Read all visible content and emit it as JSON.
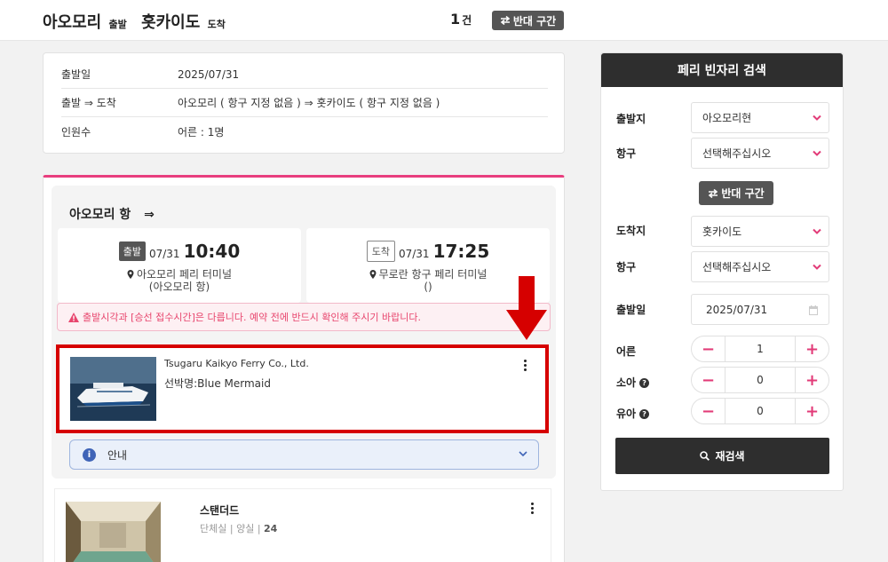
{
  "header": {
    "origin": "아오모리",
    "origin_suffix": "출발",
    "destination": "홋카이도",
    "destination_suffix": "도착",
    "count": "1",
    "count_unit": "건",
    "reverse_label": "반대 구간"
  },
  "summary": {
    "rows": [
      {
        "label": "출발일",
        "value": "2025/07/31"
      },
      {
        "label": "출발 ⇒ 도착",
        "value": "아오모리 ( 항구 지정 없음 ) ⇒ 홋카이도 ( 항구 지정 없음 )"
      },
      {
        "label": "인원수",
        "value": "어른 : 1명"
      }
    ]
  },
  "result": {
    "port_title": "아오모리 항",
    "port_arrow": "⇒",
    "departure": {
      "badge": "출발",
      "date": "07/31",
      "time": "10:40",
      "terminal": "아오모리 페리 터미널",
      "terminal_sub": "(아오모리 항)"
    },
    "arrival": {
      "badge": "도착",
      "date": "07/31",
      "time": "17:25",
      "terminal": "무로란 항구 페리 터미널",
      "terminal_sub": "()"
    },
    "warning": "출발시각과 [승선 접수시간]은 다릅니다. 예약 전에 반드시 확인해 주시기 바랍니다.",
    "ship": {
      "company": "Tsugaru Kaikyo Ferry Co., Ltd.",
      "name": "선박명:Blue Mermaid"
    },
    "info_label": "안내",
    "room": {
      "title": "스탠더드",
      "meta_1": "단체실",
      "meta_2": "양실",
      "meta_3": "24"
    }
  },
  "search": {
    "title": "페리 빈자리 검색",
    "departure_label": "출발지",
    "departure_value": "아오모리현",
    "dep_port_label": "항구",
    "dep_port_value": "선택해주십시오",
    "reverse_label": "반대 구간",
    "arrival_label": "도착지",
    "arrival_value": "홋카이도",
    "arr_port_label": "항구",
    "arr_port_value": "선택해주십시오",
    "date_label": "출발일",
    "date_value": "2025/07/31",
    "adult_label": "어른",
    "adult_value": "1",
    "child_label": "소아",
    "child_value": "0",
    "infant_label": "유아",
    "infant_value": "0",
    "minus": "−",
    "plus": "+",
    "help": "?",
    "submit_label": "재검색"
  },
  "colors": {
    "accent": "#e23b78",
    "highlight": "#d60000",
    "dark": "#2e2e2e"
  }
}
